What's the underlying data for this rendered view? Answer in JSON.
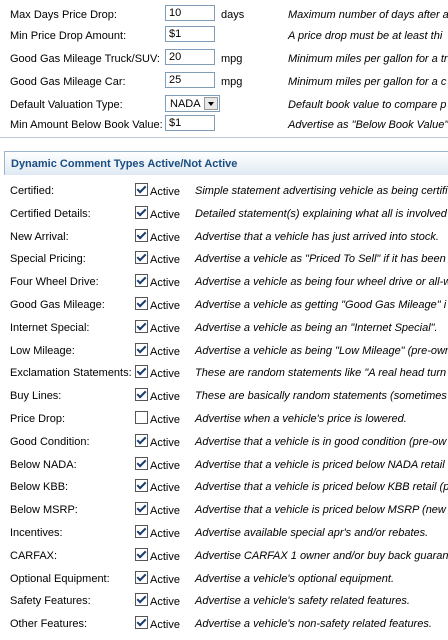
{
  "settings": [
    {
      "label": "Max Days Price Drop:",
      "value": "10",
      "unit": "days",
      "desc": "Maximum number of days after a"
    },
    {
      "label": "Min Price Drop Amount:",
      "value": "$1",
      "unit": "",
      "desc": "A price drop must be at least thi"
    },
    {
      "label": "Good Gas Mileage Truck/SUV:",
      "value": "20",
      "unit": "mpg",
      "desc": "Minimum miles per gallon for a tr"
    },
    {
      "label": "Good Gas Mileage Car:",
      "value": "25",
      "unit": "mpg",
      "desc": "Minimum miles per gallon for a c"
    },
    {
      "label": "Default Valuation Type:",
      "value": "NADA",
      "unit": "",
      "desc": "Default book value to compare p"
    },
    {
      "label": "Min Amount Below Book Value:",
      "value": "$1",
      "unit": "",
      "desc": "Advertise as \"Below Book Value\""
    }
  ],
  "section": {
    "title": "Dynamic Comment Types Active/Not Active"
  },
  "active_label": "Active",
  "types": [
    {
      "label": "Certified:",
      "checked": true,
      "desc": "Simple statement advertising vehicle as being certifi"
    },
    {
      "label": "Certified Details:",
      "checked": true,
      "desc": "Detailed statement(s) explaining what all is involved"
    },
    {
      "label": "New Arrival:",
      "checked": true,
      "desc": "Advertise that a vehicle has just arrived into stock."
    },
    {
      "label": "Special Pricing:",
      "checked": true,
      "desc": "Advertise a vehicle as \"Priced To Sell\" if it has been"
    },
    {
      "label": "Four Wheel Drive:",
      "checked": true,
      "desc": "Advertise a vehicle as being four wheel drive or all-w"
    },
    {
      "label": "Good Gas Mileage:",
      "checked": true,
      "desc": "Advertise a vehicle as getting \"Good Gas Mileage\" i"
    },
    {
      "label": "Internet Special:",
      "checked": true,
      "desc": "Advertise a vehicle as being an \"Internet Special\"."
    },
    {
      "label": "Low Mileage:",
      "checked": true,
      "desc": "Advertise a vehicle as being \"Low Mileage\" (pre-own"
    },
    {
      "label": "Exclamation Statements:",
      "checked": true,
      "desc": "These are random statements like \"A real head turn"
    },
    {
      "label": "Buy Lines:",
      "checked": true,
      "desc": "These are basically random statements (sometimes"
    },
    {
      "label": "Price Drop:",
      "checked": false,
      "desc": "Advertise when a vehicle's price is lowered."
    },
    {
      "label": "Good Condition:",
      "checked": true,
      "desc": "Advertise that a vehicle is in good condition (pre-ow"
    },
    {
      "label": "Below NADA:",
      "checked": true,
      "desc": "Advertise that a vehicle is priced below NADA retail"
    },
    {
      "label": "Below KBB:",
      "checked": true,
      "desc": "Advertise that a vehicle is priced below KBB retail (p"
    },
    {
      "label": "Below MSRP:",
      "checked": true,
      "desc": "Advertise that a vehicle is priced below MSRP (new"
    },
    {
      "label": "Incentives:",
      "checked": true,
      "desc": "Advertise available special apr's and/or rebates."
    },
    {
      "label": "CARFAX:",
      "checked": true,
      "desc": "Advertise CARFAX 1 owner and/or buy back guaran"
    },
    {
      "label": "Optional Equipment:",
      "checked": true,
      "desc": "Advertise a vehicle's optional equipment."
    },
    {
      "label": "Safety Features:",
      "checked": true,
      "desc": "Advertise a vehicle's safety related features."
    },
    {
      "label": "Other Features:",
      "checked": true,
      "desc": "Advertise a vehicle's non-safety related features."
    }
  ]
}
